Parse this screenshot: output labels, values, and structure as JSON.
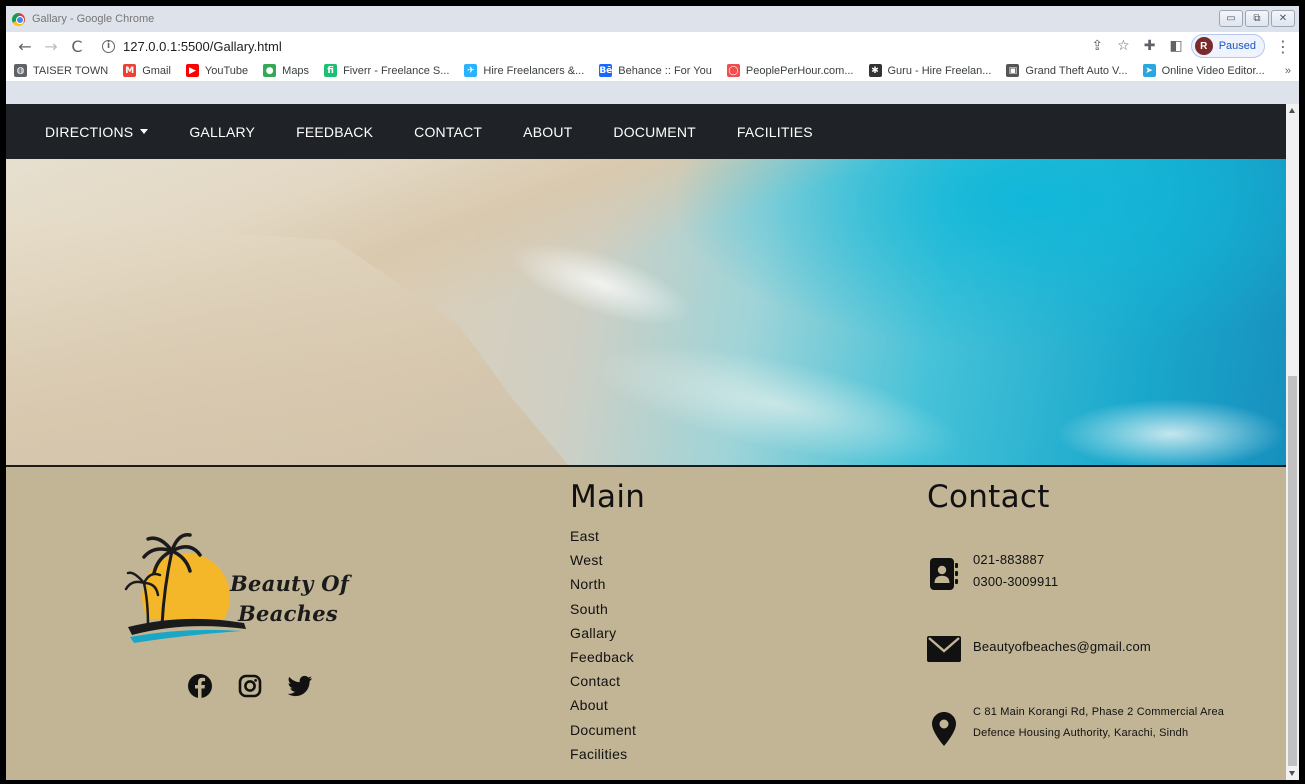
{
  "window": {
    "title": "Gallary - Google Chrome",
    "controls": {
      "minimize": "▭",
      "restore": "⧉",
      "close": "✕"
    }
  },
  "browser": {
    "back": "←",
    "forward": "→",
    "reload": "C",
    "url": "127.0.0.1:5500/Gallary.html",
    "profile_initial": "R",
    "profile_status": "Paused",
    "menu": "⋮"
  },
  "bookmarks": [
    {
      "label": "TAISER TOWN",
      "icon": "globe-icon",
      "color": "#5f6368",
      "glyph": "◍"
    },
    {
      "label": "Gmail",
      "icon": "gmail-icon",
      "color": "#ea4335",
      "glyph": "M"
    },
    {
      "label": "YouTube",
      "icon": "youtube-icon",
      "color": "#ff0000",
      "glyph": "▶"
    },
    {
      "label": "Maps",
      "icon": "maps-icon",
      "color": "#34a853",
      "glyph": "●"
    },
    {
      "label": "Fiverr - Freelance S...",
      "icon": "fiverr-icon",
      "color": "#1dbf73",
      "glyph": "fi"
    },
    {
      "label": "Hire Freelancers &...",
      "icon": "freelancer-icon",
      "color": "#29b2fe",
      "glyph": "✈"
    },
    {
      "label": "Behance :: For You",
      "icon": "behance-icon",
      "color": "#1769ff",
      "glyph": "Bē"
    },
    {
      "label": "PeoplePerHour.com...",
      "icon": "peopleperhour-icon",
      "color": "#f04e4e",
      "glyph": "◯"
    },
    {
      "label": "Guru - Hire Freelan...",
      "icon": "guru-icon",
      "color": "#333333",
      "glyph": "✱"
    },
    {
      "label": "Grand Theft Auto V...",
      "icon": "gta-icon",
      "color": "#555555",
      "glyph": "▣"
    },
    {
      "label": "Online Video Editor...",
      "icon": "video-editor-icon",
      "color": "#2aa7e0",
      "glyph": "➤"
    }
  ],
  "bookmarks_more": "»",
  "site_nav": [
    {
      "label": "DIRECTIONS",
      "dropdown": true
    },
    {
      "label": "GALLARY"
    },
    {
      "label": "FEEDBACK"
    },
    {
      "label": "CONTACT"
    },
    {
      "label": "ABOUT"
    },
    {
      "label": "DOCUMENT"
    },
    {
      "label": "FACILITIES"
    }
  ],
  "logo": {
    "line1": "Beauty Of",
    "line2": "Beaches",
    "sun_color": "#f5b72a",
    "wave_color": "#1aa7c7"
  },
  "footer": {
    "main_title": "Main",
    "main_links": [
      "East",
      "West",
      "North",
      "South",
      "Gallary",
      "Feedback",
      "Contact",
      "About",
      "Document",
      "Facilities"
    ],
    "contact_title": "Contact",
    "phones": [
      "021-883887",
      "0300-3009911"
    ],
    "email": "Beautyofbeaches@gmail.com",
    "address_line1": "C 81 Main Korangi Rd, Phase 2 Commercial Area",
    "address_line2": "Defence Housing Authority, Karachi, Sindh"
  },
  "colors": {
    "nav_bg": "#1f2327",
    "footer_bg": "#c2b596",
    "profile_accent": "#1a56c4"
  }
}
